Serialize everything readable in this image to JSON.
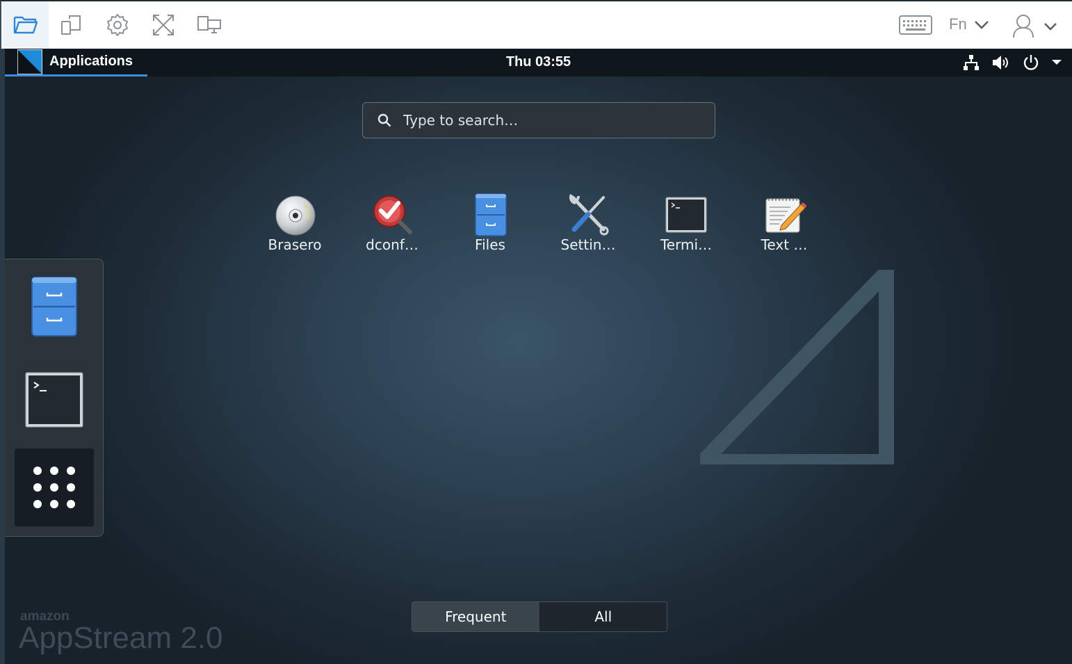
{
  "toolbar": {
    "buttons": [
      {
        "name": "folder-open-icon",
        "active": true
      },
      {
        "name": "copy-windows-icon",
        "active": false
      },
      {
        "name": "gear-icon",
        "active": false
      },
      {
        "name": "fullscreen-icon",
        "active": false
      },
      {
        "name": "multi-monitor-icon",
        "active": false
      }
    ],
    "fn_label": "Fn",
    "right_icons": [
      "keyboard-icon",
      "fn-dropdown",
      "user-icon"
    ]
  },
  "topbar": {
    "applications_label": "Applications",
    "clock": "Thu 03:55",
    "status_icons": [
      "network-icon",
      "volume-icon",
      "power-icon",
      "caret-down-icon"
    ]
  },
  "search": {
    "placeholder": "Type to search…"
  },
  "apps": [
    {
      "label": "Brasero",
      "icon": "disc-icon"
    },
    {
      "label": "dconf…",
      "icon": "dconf-icon"
    },
    {
      "label": "Files",
      "icon": "file-cabinet-icon"
    },
    {
      "label": "Settin…",
      "icon": "settings-tools-icon"
    },
    {
      "label": "Termi…",
      "icon": "terminal-icon"
    },
    {
      "label": "Text …",
      "icon": "text-editor-icon"
    }
  ],
  "dock": {
    "items": [
      "file-cabinet-icon",
      "terminal-icon",
      "show-apps-icon"
    ]
  },
  "switcher": {
    "frequent_label": "Frequent",
    "all_label": "All",
    "active": "Frequent"
  },
  "brand": {
    "small": "amazon",
    "big": "AppStream 2.0"
  },
  "colors": {
    "accent": "#3c8de0",
    "topbar": "#0f171d",
    "folder": "#4a90e2"
  }
}
